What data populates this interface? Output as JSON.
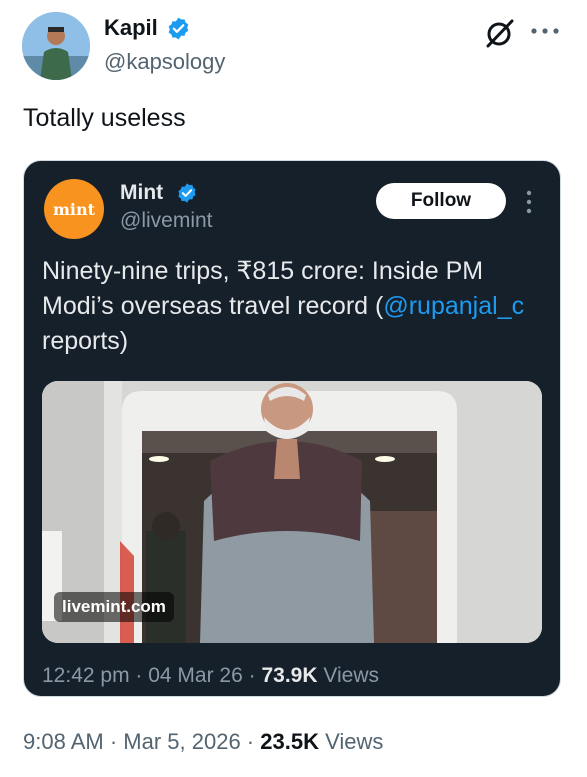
{
  "author": {
    "name": "Kapil",
    "handle": "@kapsology"
  },
  "tweet": {
    "text": "Totally useless"
  },
  "quoted": {
    "name": "Mint",
    "handle": "@livemint",
    "avatar_text": "mint",
    "follow_label": "Follow",
    "text_main": "Ninety-nine trips, ₹815 crore: Inside PM Modi’s overseas travel record (",
    "mention": "@rupanjal_c",
    "text_end": " reports)",
    "image_watermark": "livemint.com",
    "time": "12:42 pm",
    "date": "04 Mar 26",
    "views_count": "73.9K",
    "views_label": "Views"
  },
  "footer": {
    "time": "9:08 AM",
    "date": "Mar 5, 2026",
    "views_count": "23.5K",
    "views_label": "Views"
  },
  "colors": {
    "accent": "#1d9bf0",
    "mint_brand": "#f7931e",
    "card_bg": "#15202b"
  },
  "icons": [
    "verified-badge-icon",
    "grok-icon",
    "more-icon"
  ]
}
